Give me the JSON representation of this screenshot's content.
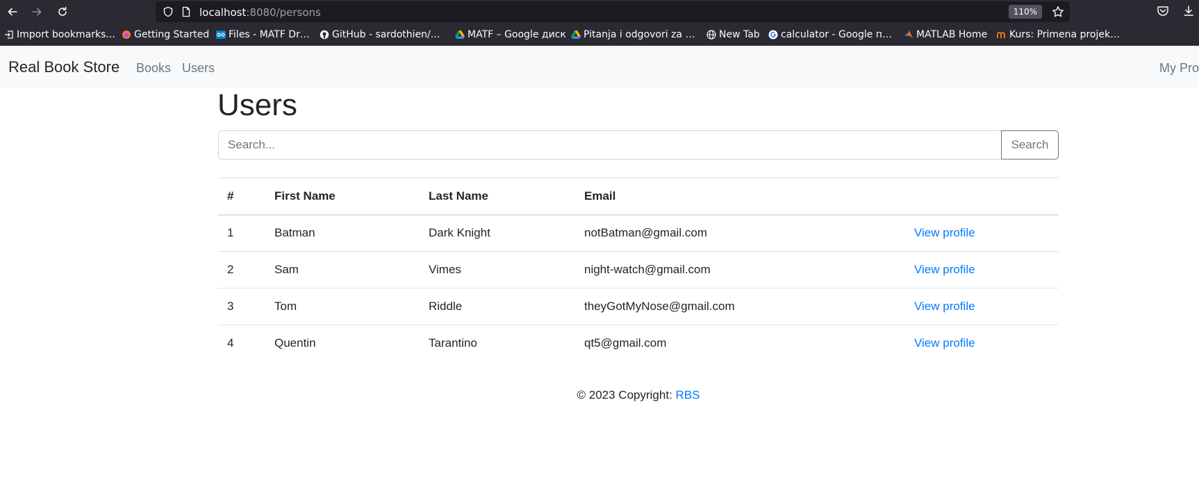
{
  "browser": {
    "url_host": "localhost",
    "url_rest": ":8080/persons",
    "zoom": "110%",
    "bookmarks": [
      {
        "label": "Import bookmarks...",
        "icon": "import-icon"
      },
      {
        "label": "Getting Started",
        "icon": "firefox-icon"
      },
      {
        "label": "Files - MATF Drajv",
        "icon": "nextcloud-icon"
      },
      {
        "label": "GitHub - sardothien/...",
        "icon": "github-icon"
      },
      {
        "label": "MATF – Google диск",
        "icon": "google-drive-icon"
      },
      {
        "label": "Pitanja i odgovori za u...",
        "icon": "google-drive-icon"
      },
      {
        "label": "New Tab",
        "icon": "globe-icon"
      },
      {
        "label": "calculator - Google пр...",
        "icon": "google-icon"
      },
      {
        "label": "MATLAB Home",
        "icon": "matlab-icon"
      },
      {
        "label": "Kurs: Primena projekti...",
        "icon": "moodle-icon"
      }
    ]
  },
  "navbar": {
    "brand": "Real Book Store",
    "links": [
      "Books",
      "Users"
    ],
    "profile": "My Pro"
  },
  "page": {
    "title": "Users",
    "search_placeholder": "Search...",
    "search_button": "Search"
  },
  "table": {
    "headers": [
      "#",
      "First Name",
      "Last Name",
      "Email"
    ],
    "link_label": "View profile",
    "rows": [
      {
        "id": "1",
        "first": "Batman",
        "last": "Dark Knight",
        "email": "notBatman@gmail.com"
      },
      {
        "id": "2",
        "first": "Sam",
        "last": "Vimes",
        "email": "night-watch@gmail.com"
      },
      {
        "id": "3",
        "first": "Tom",
        "last": "Riddle",
        "email": "theyGotMyNose@gmail.com"
      },
      {
        "id": "4",
        "first": "Quentin",
        "last": "Tarantino",
        "email": "qt5@gmail.com"
      }
    ]
  },
  "footer": {
    "text": "© 2023 Copyright: ",
    "link": "RBS"
  },
  "colors": {
    "link": "#007bff",
    "navbar_bg": "#f8f9fa",
    "browser_chrome": "#2b2a33"
  }
}
